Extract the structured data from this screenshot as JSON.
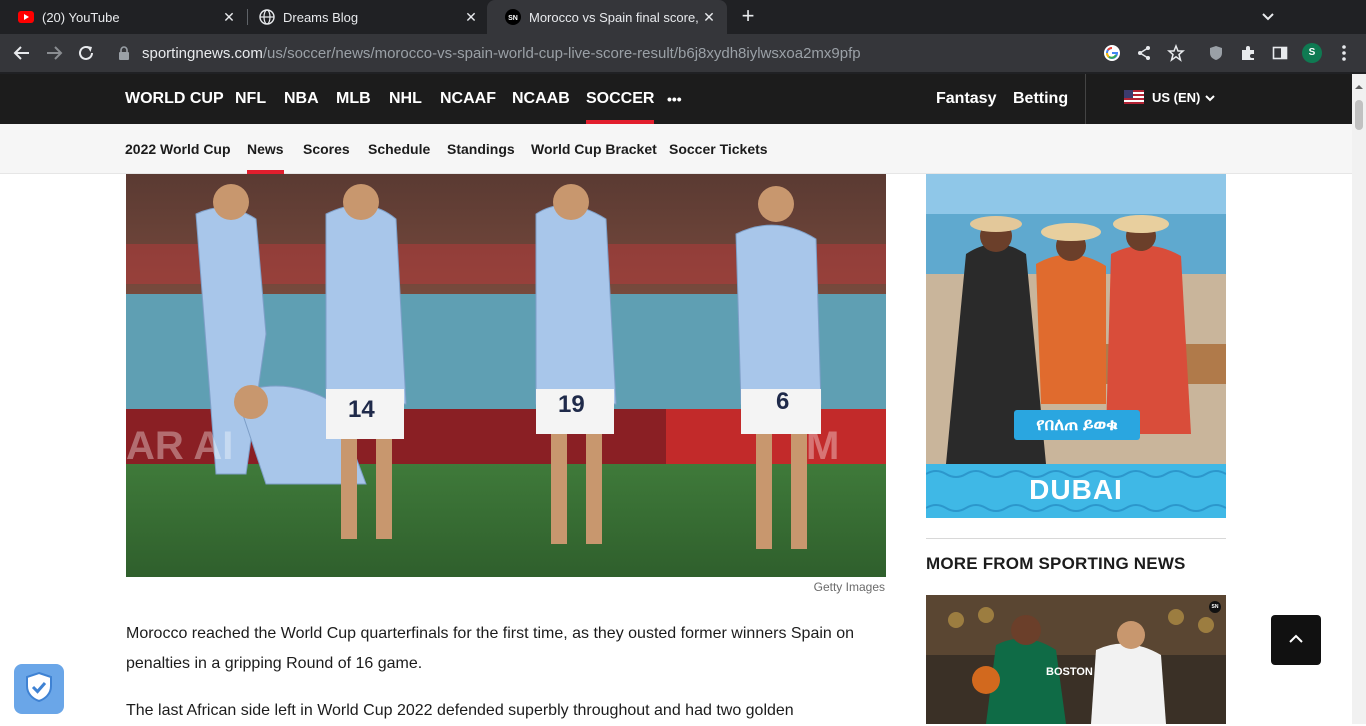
{
  "browser": {
    "tabs": [
      {
        "title": "(20) YouTube",
        "icon": "youtube-icon"
      },
      {
        "title": "Dreams Blog",
        "icon": "globe-icon"
      },
      {
        "title": "Morocco vs Spain final score,",
        "icon": "sporting-news-icon",
        "favicon_text": "SN"
      }
    ],
    "url_host": "sportingnews.com",
    "url_path": "/us/soccer/news/morocco-vs-spain-world-cup-live-score-result/b6j8xydh8iylwsxoa2mx9pfp",
    "profile_initial": "S"
  },
  "site_nav": {
    "items": [
      "WORLD CUP",
      "NFL",
      "NBA",
      "MLB",
      "NHL",
      "NCAAF",
      "NCAAB",
      "SOCCER"
    ],
    "active": "SOCCER",
    "more_label": "•••",
    "right_items": [
      "Fantasy",
      "Betting"
    ],
    "region": "US (EN)"
  },
  "sub_nav": {
    "items": [
      "2022 World Cup",
      "News",
      "Scores",
      "Schedule",
      "Standings",
      "World Cup Bracket",
      "Soccer Tickets"
    ],
    "active": "News"
  },
  "article": {
    "photo_credit": "Getty Images",
    "paragraphs": [
      "Morocco reached the World Cup quarterfinals for the first time, as they ousted former winners Spain on penalties in a gripping Round of 16 game.",
      "The last African side left in World Cup 2022 defended superbly throughout and had two golden"
    ]
  },
  "sidebar": {
    "ad_button": "የበለጠ ይወቁ",
    "ad_brand": "DUBAI",
    "more_heading": "MORE FROM SPORTING NEWS",
    "thumb_badge": "SN"
  },
  "colors": {
    "accent_red": "#e21e2d",
    "nav_bg": "#1c1c1c",
    "chrome_bg": "#202124"
  }
}
